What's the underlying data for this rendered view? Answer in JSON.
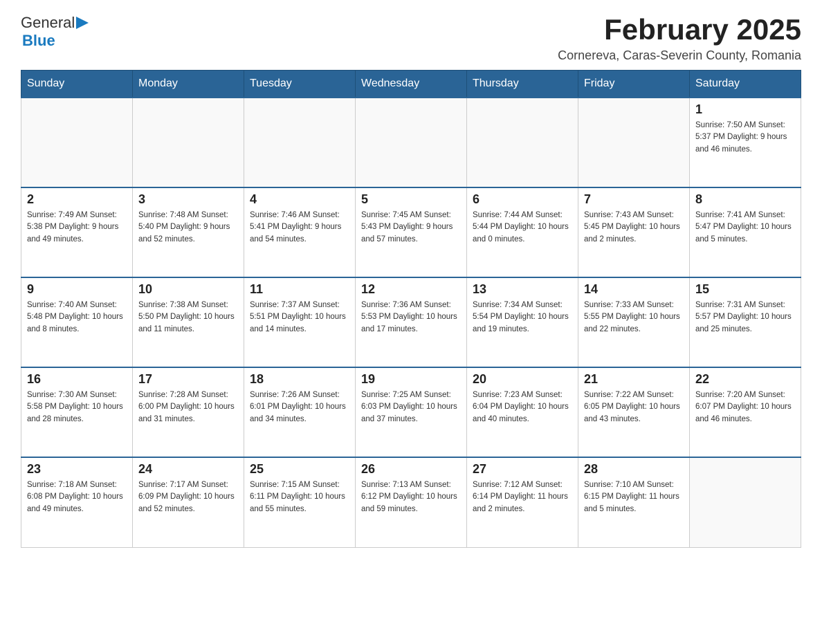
{
  "header": {
    "logo": {
      "text_general": "General",
      "text_blue": "Blue",
      "alt": "GeneralBlue logo"
    },
    "title": "February 2025",
    "location": "Cornereva, Caras-Severin County, Romania"
  },
  "calendar": {
    "days_of_week": [
      "Sunday",
      "Monday",
      "Tuesday",
      "Wednesday",
      "Thursday",
      "Friday",
      "Saturday"
    ],
    "weeks": [
      [
        {
          "day": "",
          "info": ""
        },
        {
          "day": "",
          "info": ""
        },
        {
          "day": "",
          "info": ""
        },
        {
          "day": "",
          "info": ""
        },
        {
          "day": "",
          "info": ""
        },
        {
          "day": "",
          "info": ""
        },
        {
          "day": "1",
          "info": "Sunrise: 7:50 AM\nSunset: 5:37 PM\nDaylight: 9 hours and 46 minutes."
        }
      ],
      [
        {
          "day": "2",
          "info": "Sunrise: 7:49 AM\nSunset: 5:38 PM\nDaylight: 9 hours and 49 minutes."
        },
        {
          "day": "3",
          "info": "Sunrise: 7:48 AM\nSunset: 5:40 PM\nDaylight: 9 hours and 52 minutes."
        },
        {
          "day": "4",
          "info": "Sunrise: 7:46 AM\nSunset: 5:41 PM\nDaylight: 9 hours and 54 minutes."
        },
        {
          "day": "5",
          "info": "Sunrise: 7:45 AM\nSunset: 5:43 PM\nDaylight: 9 hours and 57 minutes."
        },
        {
          "day": "6",
          "info": "Sunrise: 7:44 AM\nSunset: 5:44 PM\nDaylight: 10 hours and 0 minutes."
        },
        {
          "day": "7",
          "info": "Sunrise: 7:43 AM\nSunset: 5:45 PM\nDaylight: 10 hours and 2 minutes."
        },
        {
          "day": "8",
          "info": "Sunrise: 7:41 AM\nSunset: 5:47 PM\nDaylight: 10 hours and 5 minutes."
        }
      ],
      [
        {
          "day": "9",
          "info": "Sunrise: 7:40 AM\nSunset: 5:48 PM\nDaylight: 10 hours and 8 minutes."
        },
        {
          "day": "10",
          "info": "Sunrise: 7:38 AM\nSunset: 5:50 PM\nDaylight: 10 hours and 11 minutes."
        },
        {
          "day": "11",
          "info": "Sunrise: 7:37 AM\nSunset: 5:51 PM\nDaylight: 10 hours and 14 minutes."
        },
        {
          "day": "12",
          "info": "Sunrise: 7:36 AM\nSunset: 5:53 PM\nDaylight: 10 hours and 17 minutes."
        },
        {
          "day": "13",
          "info": "Sunrise: 7:34 AM\nSunset: 5:54 PM\nDaylight: 10 hours and 19 minutes."
        },
        {
          "day": "14",
          "info": "Sunrise: 7:33 AM\nSunset: 5:55 PM\nDaylight: 10 hours and 22 minutes."
        },
        {
          "day": "15",
          "info": "Sunrise: 7:31 AM\nSunset: 5:57 PM\nDaylight: 10 hours and 25 minutes."
        }
      ],
      [
        {
          "day": "16",
          "info": "Sunrise: 7:30 AM\nSunset: 5:58 PM\nDaylight: 10 hours and 28 minutes."
        },
        {
          "day": "17",
          "info": "Sunrise: 7:28 AM\nSunset: 6:00 PM\nDaylight: 10 hours and 31 minutes."
        },
        {
          "day": "18",
          "info": "Sunrise: 7:26 AM\nSunset: 6:01 PM\nDaylight: 10 hours and 34 minutes."
        },
        {
          "day": "19",
          "info": "Sunrise: 7:25 AM\nSunset: 6:03 PM\nDaylight: 10 hours and 37 minutes."
        },
        {
          "day": "20",
          "info": "Sunrise: 7:23 AM\nSunset: 6:04 PM\nDaylight: 10 hours and 40 minutes."
        },
        {
          "day": "21",
          "info": "Sunrise: 7:22 AM\nSunset: 6:05 PM\nDaylight: 10 hours and 43 minutes."
        },
        {
          "day": "22",
          "info": "Sunrise: 7:20 AM\nSunset: 6:07 PM\nDaylight: 10 hours and 46 minutes."
        }
      ],
      [
        {
          "day": "23",
          "info": "Sunrise: 7:18 AM\nSunset: 6:08 PM\nDaylight: 10 hours and 49 minutes."
        },
        {
          "day": "24",
          "info": "Sunrise: 7:17 AM\nSunset: 6:09 PM\nDaylight: 10 hours and 52 minutes."
        },
        {
          "day": "25",
          "info": "Sunrise: 7:15 AM\nSunset: 6:11 PM\nDaylight: 10 hours and 55 minutes."
        },
        {
          "day": "26",
          "info": "Sunrise: 7:13 AM\nSunset: 6:12 PM\nDaylight: 10 hours and 59 minutes."
        },
        {
          "day": "27",
          "info": "Sunrise: 7:12 AM\nSunset: 6:14 PM\nDaylight: 11 hours and 2 minutes."
        },
        {
          "day": "28",
          "info": "Sunrise: 7:10 AM\nSunset: 6:15 PM\nDaylight: 11 hours and 5 minutes."
        },
        {
          "day": "",
          "info": ""
        }
      ]
    ]
  }
}
